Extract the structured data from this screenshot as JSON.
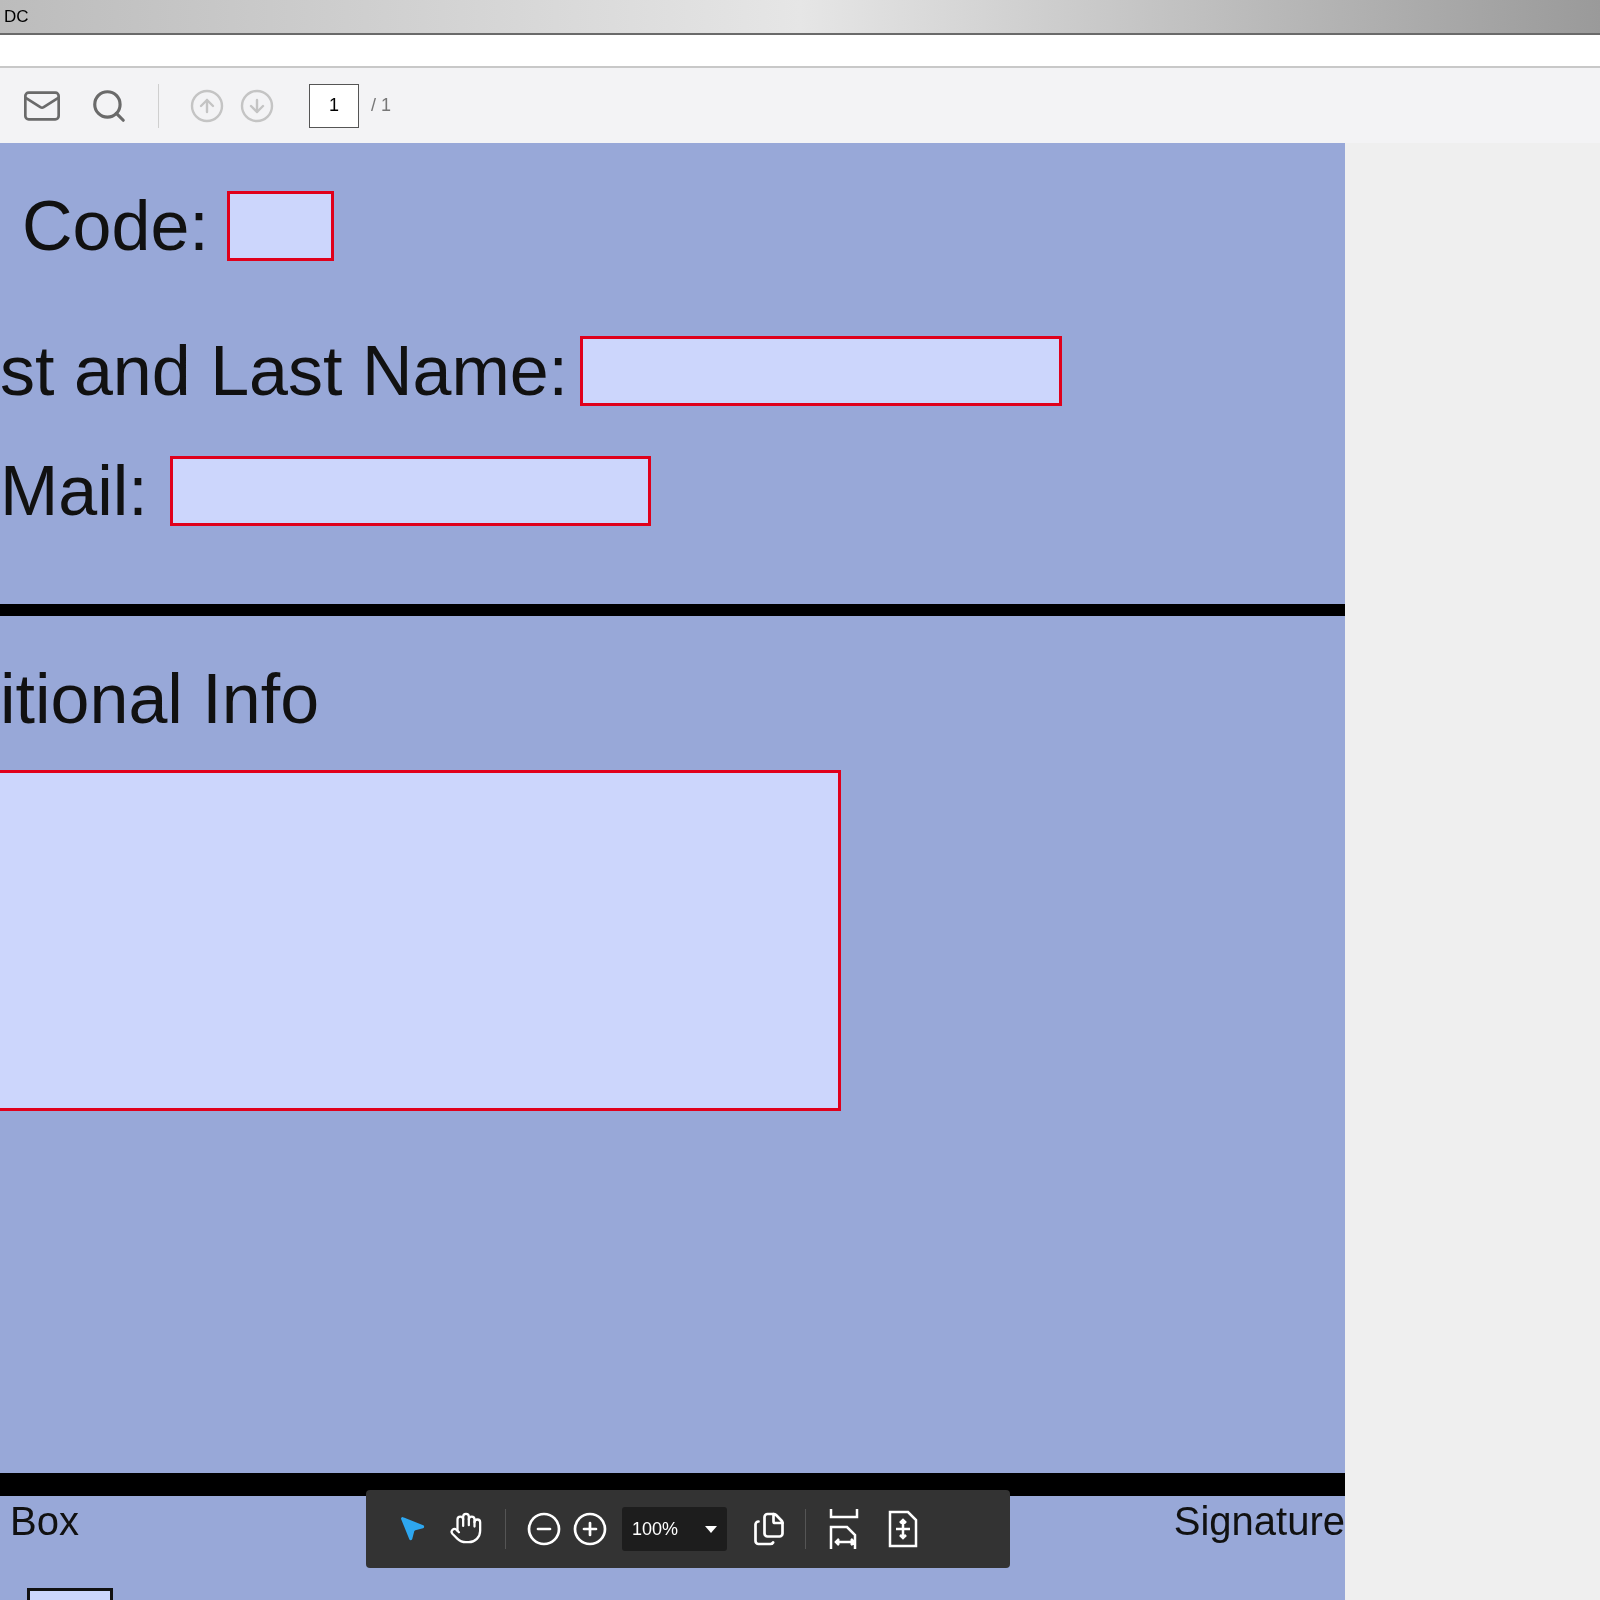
{
  "window": {
    "title": "DC"
  },
  "toolbar": {
    "page_field": {
      "value": "1"
    },
    "page_count": "/ 1",
    "prev_disabled": true,
    "next_disabled": true
  },
  "form": {
    "fields": [
      {
        "label": "Code:"
      },
      {
        "label": "st and Last Name:"
      },
      {
        "label": "Mail:"
      }
    ],
    "section_title": "itional Info",
    "footer_labels": [
      "Box",
      "Signature"
    ],
    "checkbox": {
      "checked": false
    }
  },
  "float_toolbar": {
    "zoom": "100%",
    "tools": [
      {
        "kind": "select",
        "selected": true
      },
      {
        "kind": "hand",
        "selected": false
      }
    ]
  }
}
